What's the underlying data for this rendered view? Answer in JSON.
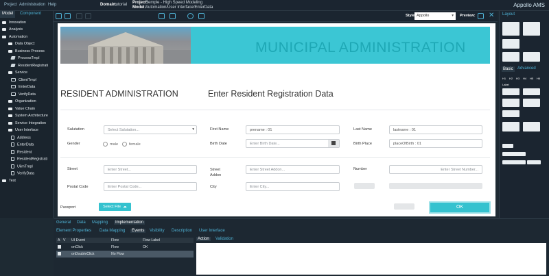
{
  "topbar": {
    "menu": [
      "Project",
      "Administration",
      "Help"
    ],
    "domain_label": "Domain:",
    "domain_value": "tutorial",
    "project_label": "Project:",
    "project_value": "Semple - High Speed Modeling",
    "model_label": "Model:",
    "model_value": "Automation/User Interface/EnterData",
    "logo": "Appollo AMS"
  },
  "left": {
    "tabs": [
      "Model",
      "Component"
    ],
    "tree": [
      "Innovation",
      "Analysis",
      "Automation",
      "Data Object",
      "Business Process",
      "ProcessTmpl",
      "ResidentRegistrati",
      "Service",
      "ClientTmpl",
      "EnterData",
      "VerifyData",
      "Organization",
      "Value Chain",
      "System Architecture",
      "Service Integration",
      "User Interface",
      "Address",
      "EnterData",
      "Resident",
      "ResidentRegistrati",
      "UiimTmpl",
      "VerifyData",
      "Test"
    ]
  },
  "toolbar": {
    "style_label": "Style:",
    "style_value": "Appollo",
    "preview_label": "Preview:"
  },
  "form": {
    "banner": "MUNICIPAL ADMINISTRATION",
    "title_left": "RESIDENT ADMINISTRATION",
    "title_right": "Enter Resident Registration Data",
    "salutation_label": "Salutation",
    "salutation_placeholder": "Select Salutation...",
    "gender_label": "Gender",
    "gender_male": "male",
    "gender_female": "female",
    "firstname_label": "First Name",
    "firstname_value": "prename : 01",
    "birthdate_label": "Birth Date",
    "birthdate_placeholder": "Enter Birth Date...",
    "lastname_label": "Last Name",
    "lastname_value": "lastname : 01",
    "birthplace_label": "Birth Place",
    "birthplace_value": "placeOfBirth : 01",
    "street_label": "Street",
    "street_placeholder": "Enter Street...",
    "street_addon_label": "Street Addon",
    "street_addon_placeholder": "Enter Street Addon...",
    "number_label": "Number",
    "number_placeholder": "Enter Street Number...",
    "postal_label": "Postal Code",
    "postal_placeholder": "Enter Postal Code...",
    "city_label": "City",
    "city_placeholder": "Enter City...",
    "passport_label": "Passport",
    "select_file": "Select File",
    "ok": "OK"
  },
  "right": {
    "tabs": [
      "Layout"
    ],
    "tabs2": [
      "Basic",
      "Advanced"
    ],
    "headings": [
      "H1",
      "H2",
      "H3",
      "H4",
      "H5",
      "H6"
    ],
    "label_text": "Label"
  },
  "bottom": {
    "tabs1": [
      "General",
      "Data",
      "Mapping",
      "Implementation"
    ],
    "tabs2": [
      "Element Properties",
      "Data Mapping",
      "Events",
      "Visibility",
      "Description",
      "User Interface"
    ],
    "grid_headers": [
      "A",
      "V",
      "UI Event",
      "Flow",
      "Flow Label"
    ],
    "rows": [
      {
        "event": "onClick",
        "flow": "Flow",
        "label": "OK"
      },
      {
        "event": "onDoubleClick",
        "flow": "No Flow",
        "label": ""
      }
    ],
    "action_tabs": [
      "Action",
      "Validation"
    ]
  }
}
